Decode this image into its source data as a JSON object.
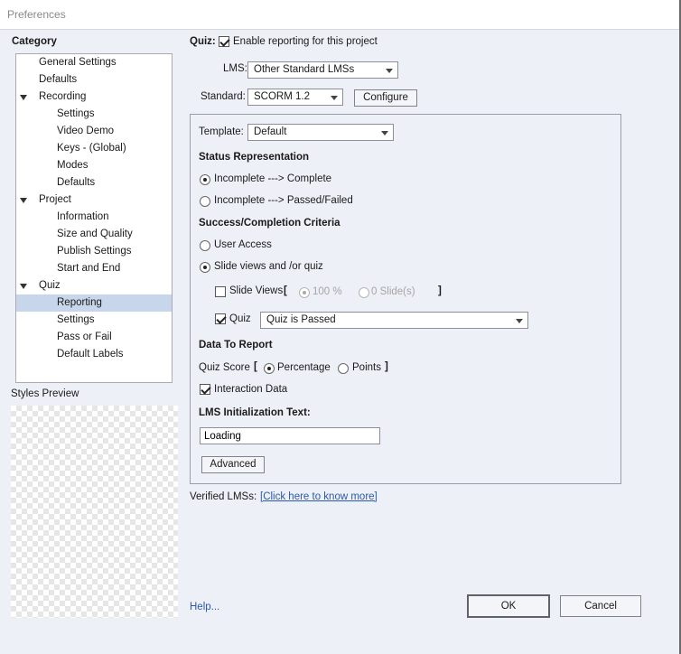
{
  "window": {
    "title": "Preferences"
  },
  "category": {
    "title": "Category",
    "items": [
      {
        "label": "General Settings"
      },
      {
        "label": "Defaults"
      },
      {
        "label": "Recording"
      },
      {
        "label": "Settings"
      },
      {
        "label": "Video Demo"
      },
      {
        "label": "Keys - (Global)"
      },
      {
        "label": "Modes"
      },
      {
        "label": "Defaults"
      },
      {
        "label": "Project"
      },
      {
        "label": "Information"
      },
      {
        "label": "Size and Quality"
      },
      {
        "label": "Publish Settings"
      },
      {
        "label": "Start and End"
      },
      {
        "label": "Quiz"
      },
      {
        "label": "Reporting"
      },
      {
        "label": "Settings"
      },
      {
        "label": "Pass or Fail"
      },
      {
        "label": "Default Labels"
      }
    ],
    "selected": "Reporting"
  },
  "styles_preview": {
    "label": "Styles Preview"
  },
  "quiz": {
    "label": "Quiz:",
    "enable_reporting_label": "Enable reporting for this project",
    "enable_reporting_checked": true
  },
  "lms": {
    "label": "LMS:",
    "value": "Other Standard LMSs"
  },
  "standard": {
    "label": "Standard:",
    "value": "SCORM 1.2",
    "configure_label": "Configure"
  },
  "template": {
    "label": "Template:",
    "value": "Default"
  },
  "status_representation": {
    "heading": "Status Representation",
    "option1": "Incomplete ---> Complete",
    "option2": "Incomplete ---> Passed/Failed",
    "selected": "Incomplete ---> Complete"
  },
  "success_criteria": {
    "heading": "Success/Completion Criteria",
    "user_access": "User Access",
    "slide_views_quiz": "Slide views and /or quiz",
    "selected": "Slide views and /or quiz",
    "slide_views_label": "Slide Views",
    "slide_views_checked": false,
    "bracket_open": "[",
    "bracket_close": "]",
    "percent_label": "100 %",
    "slides_label": "0 Slide(s)",
    "quiz_label": "Quiz",
    "quiz_checked": true,
    "quiz_condition": "Quiz is Passed"
  },
  "data_to_report": {
    "heading": "Data To Report",
    "quiz_score_label": "Quiz Score",
    "bracket_open": "[",
    "bracket_close": "]",
    "percentage_label": "Percentage",
    "points_label": "Points",
    "selected": "Percentage",
    "interaction_data_label": "Interaction Data",
    "interaction_data_checked": true
  },
  "lms_init": {
    "heading": "LMS Initialization Text:",
    "value": "Loading",
    "advanced_label": "Advanced"
  },
  "verified": {
    "label": "Verified LMSs:",
    "link_text": "[Click here to know more]"
  },
  "footer": {
    "help_label": "Help...",
    "ok_label": "OK",
    "cancel_label": "Cancel"
  }
}
